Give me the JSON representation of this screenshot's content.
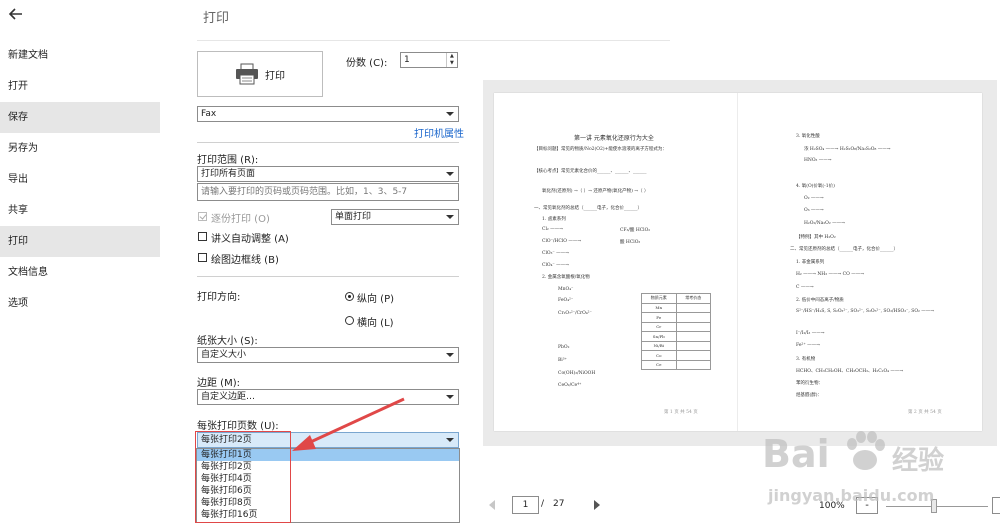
{
  "sidebar": {
    "back_icon": "arrow-left-icon",
    "items": [
      {
        "label": "新建文档"
      },
      {
        "label": "打开"
      },
      {
        "label": "保存"
      },
      {
        "label": "另存为"
      },
      {
        "label": "导出"
      },
      {
        "label": "共享"
      },
      {
        "label": "打印"
      },
      {
        "label": "文档信息"
      },
      {
        "label": "选项"
      }
    ],
    "active_index": 2,
    "highlight_index": 6
  },
  "print": {
    "title": "打印",
    "print_button": "打印",
    "copies_label": "份数 (C):",
    "copies_value": "1",
    "printer": "Fax",
    "printer_props_link": "打印机属性",
    "range_label": "打印范围 (R):",
    "range_value": "打印所有页面",
    "pages_placeholder": "请输入要打印的页码或页码范围。比如，1、3、5-7",
    "collate_label": "逐份打印 (O)",
    "duplex_value": "单面打印",
    "auto_adjust_label": "讲义自动调整 (A)",
    "draw_border_label": "绘图边框线 (B)",
    "orientation_label": "打印方向:",
    "portrait_label": "纵向 (P)",
    "landscape_label": "横向 (L)",
    "paper_label": "纸张大小 (S):",
    "paper_value": "自定义大小",
    "margin_label": "边距 (M):",
    "margin_value": "自定义边距…",
    "pps_label": "每张打印页数 (U):",
    "pps_value": "每张打印2页",
    "pps_options": [
      "每张打印1页",
      "每张打印2页",
      "每张打印4页",
      "每张打印6页",
      "每张打印8页",
      "每张打印16页"
    ],
    "pps_highlight_index": 0
  },
  "preview": {
    "left_page": {
      "title": "第一讲  元素氧化还原行为大全",
      "lines": [
        "【目标问题】常见的物质/No2(O2)+能使水溶液的离子方程式为：",
        "【核心考点】常见元素化合价的______、______、______",
        "氧化剂(还原剂) →（    ）→ 还原产物(氧化产物) →（    ）",
        "一、常见氧化剂的总结（______电子，化合价______）",
        "1. 卤素系列",
        "Cl₂ ——→",
        "ClO⁻/HClO ——→",
        "ClO₃⁻ ——→",
        "ClO₄⁻ ——→",
        "2. 金属含氧酸根/氧化物",
        "MnO₄⁻",
        "FeO₄²⁻",
        "Cr₂O₇²⁻/CrO₄²⁻",
        "PbO₂",
        "Bi³⁺",
        "Co(OH)₃/NiOOH",
        "CeO₂/Ce⁴⁺"
      ],
      "right_col": [
        "CF₃/酸 HClO₂",
        "酸 HClO₃"
      ],
      "table_header": [
        "物质元素",
        "常考价态"
      ],
      "table_rows": [
        "Mn",
        "Fe",
        "Cr",
        "Sn/Pb",
        "Ni/Bi",
        "Co",
        "Ce"
      ],
      "footer": "第 1 页 共 54 页"
    },
    "right_page": {
      "lines": [
        "3. 氧化性酸",
        "浓 H₂SO₄ ——→          H₂S₂O₈/Na₂S₂O₈ ——→",
        "HNO₃ ——→",
        "4. 氧(O)价氧(-1价)",
        "O₂ ——→",
        "O₃ ——→",
        "H₂O₂/Na₂O₂ ——→",
        "【特例】其中 H₂O₂",
        "二、常见还原剂的总结（______电子，化合价______）",
        "1. 非金属系列",
        "H₂ ——→          NH₃ ——→          CO ——→",
        "C ——→",
        "2. 低价中间态离子/物质",
        "S²⁻/HS⁻/H₂S, S, S₂O₃²⁻, SO₃²⁻, S₂O₅²⁻, SO₂/HSO₃⁻, SO₂ ——→",
        "I⁻/I₂/I₃ ——→",
        "Fe²⁺ ——→",
        "3. 有机物",
        "HCHO、CH₃CH₂OH、CH₃OCH₃、H₂C₂O₄ ——→",
        "苯的衍生物：",
        "烃基醛(醇)："
      ],
      "footer": "第 2 页 共 54 页"
    }
  },
  "pager": {
    "current_page": "1",
    "separator": "/",
    "total_pages": "27",
    "zoom": "100%",
    "zoom_minus": "-"
  },
  "watermark": {
    "brand": "Bai",
    "brand_suffix": "经验",
    "url": "jingyan.baidu.com"
  },
  "colors": {
    "sidebar_active_bg": "#e6e6e6",
    "link": "#1a66cc",
    "dropdown_highlight": "#99c9f2",
    "annotation_red": "#e04848"
  }
}
